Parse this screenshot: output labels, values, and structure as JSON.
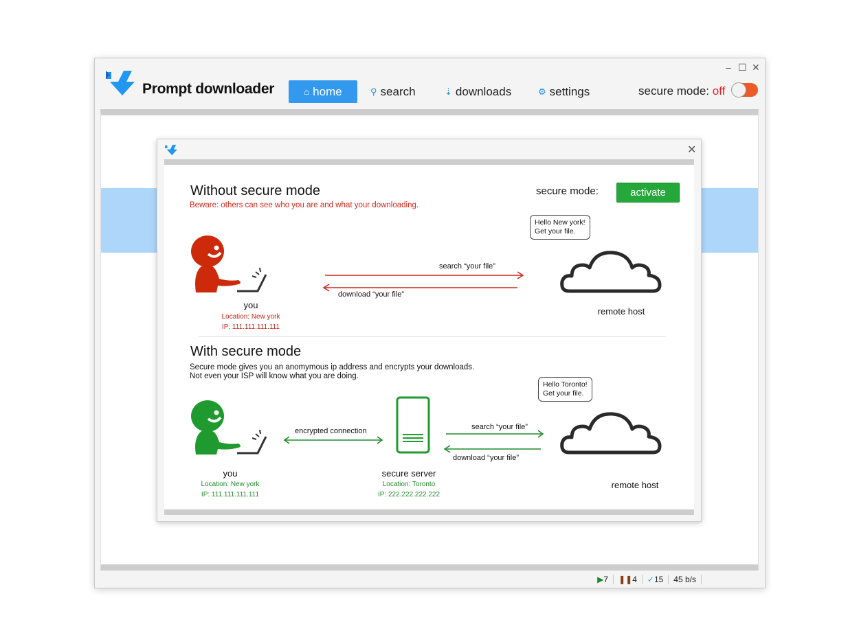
{
  "app": {
    "title": "Prompt downloader",
    "window_controls": {
      "minimize": "–",
      "maximize": "☐",
      "close": "✕"
    }
  },
  "nav": {
    "home": "home",
    "search": "search",
    "downloads": "downloads",
    "settings": "settings"
  },
  "secure_mode": {
    "label": "secure mode:",
    "state": "off",
    "enabled": false
  },
  "status_bar": {
    "active": "7",
    "paused": "4",
    "completed": "15",
    "speed": "45 b/s"
  },
  "dialog": {
    "close": "✕",
    "secure_mode_label": "secure mode:",
    "activate_button": "activate",
    "without": {
      "title": "Without secure mode",
      "warning": "Beware: others can see who you are and what your downloading.",
      "you_label": "you",
      "location": "Location: New york",
      "ip": "IP: 111.111.111.111",
      "search_arrow": "search “your file”",
      "download_arrow": "download “your file”",
      "bubble_line1": "Hello New york!",
      "bubble_line2": "Get your file.",
      "remote_host": "remote host"
    },
    "with": {
      "title": "With secure mode",
      "desc_line1": "Secure mode gives you an anomymous ip address and encrypts your downloads.",
      "desc_line2": "Not even your ISP will know what you are doing.",
      "you_label": "you",
      "location": "Location: New york",
      "ip": "IP: 111.111.111.111",
      "encrypted": "encrypted connection",
      "server_label": "secure server",
      "server_location": "Location: Toronto",
      "server_ip": "IP: 222.222.222.222",
      "search_arrow": "search “your file”",
      "download_arrow": "download “your file”",
      "bubble_line1": "Hello Toronto!",
      "bubble_line2": "Get your file.",
      "remote_host": "remote host"
    }
  },
  "colors": {
    "accent": "#3399ee",
    "brand": "#1e90e6",
    "danger": "#c8281c",
    "safe": "#1f8a2a",
    "toggle_off": "#ec5a27",
    "highlight_band": "#aed6fa"
  },
  "icons": {
    "logo": "download-arrow-icon",
    "home": "home-icon",
    "search": "search-icon",
    "downloads": "downloads-icon",
    "settings": "gear-icon"
  }
}
